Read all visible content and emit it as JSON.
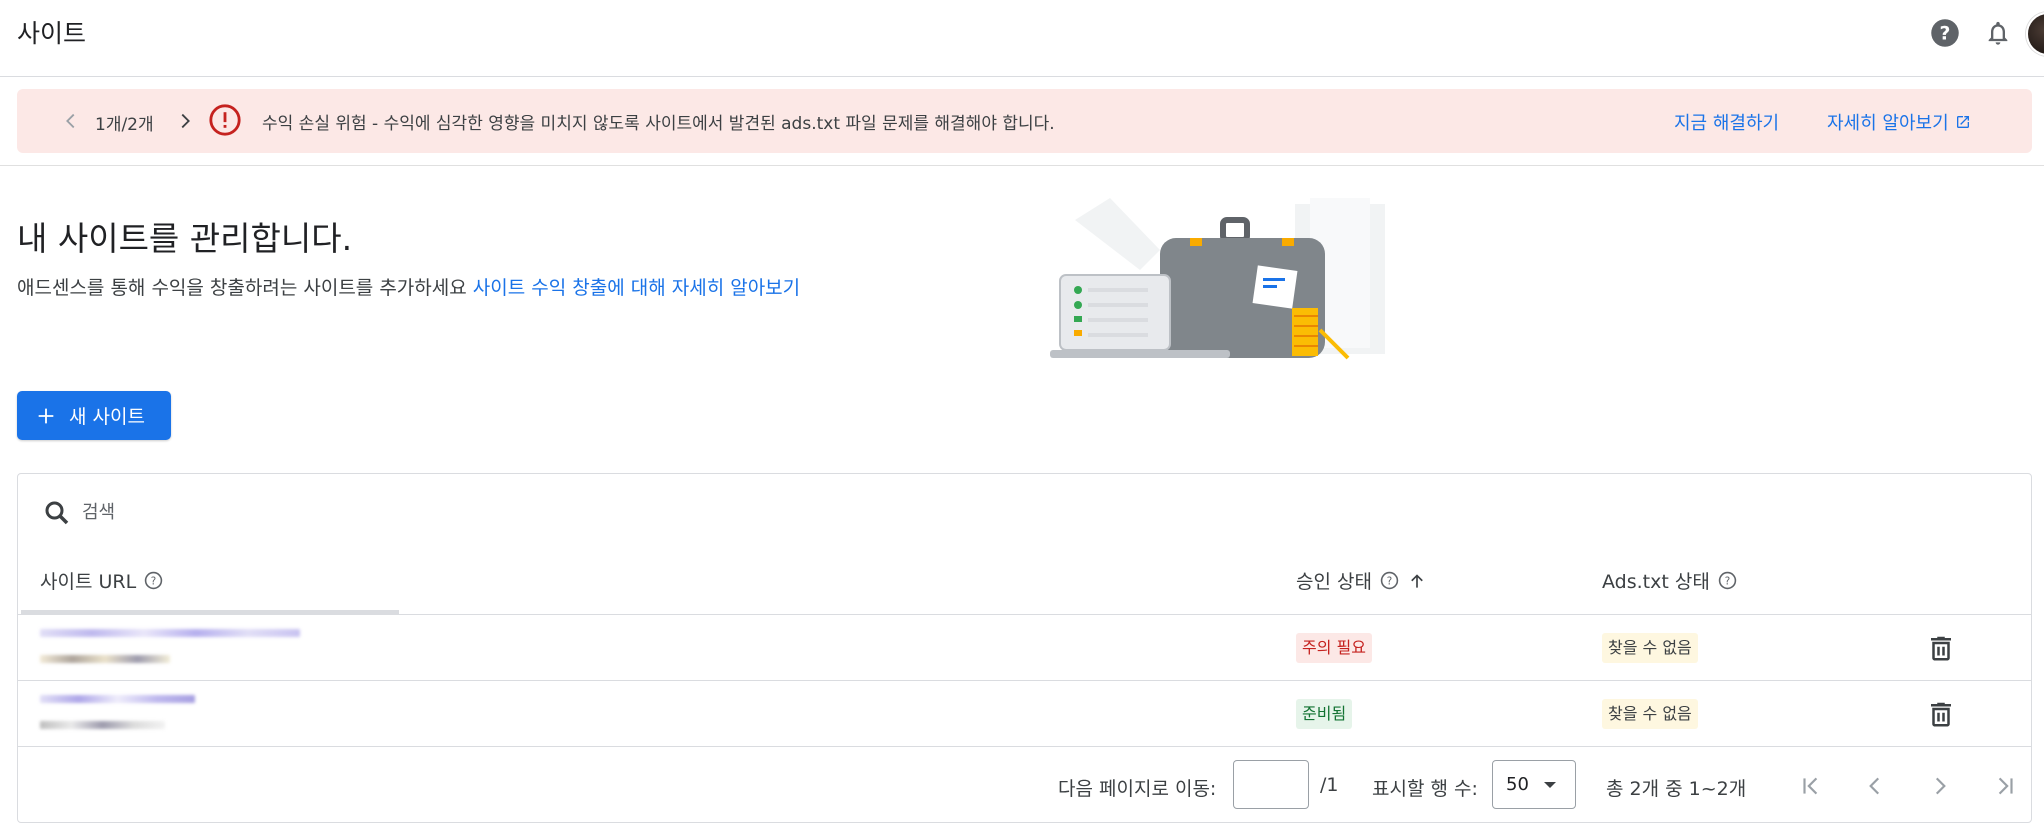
{
  "header": {
    "title": "사이트"
  },
  "banner": {
    "counter": "1개/2개",
    "message": "수익 손실 위험 - 수익에 심각한 영향을 미치지 않도록 사이트에서 발견된 ads.txt 파일 문제를 해결해야 합니다.",
    "fix_link": "지금 해결하기",
    "learn_link": "자세히 알아보기"
  },
  "hero": {
    "title": "내 사이트를 관리합니다.",
    "description": "애드센스를 통해 수익을 창출하려는 사이트를 추가하세요",
    "link": "사이트 수익 창출에 대해 자세히 알아보기"
  },
  "new_site_button": "새 사이트",
  "search": {
    "placeholder": "검색"
  },
  "table": {
    "columns": {
      "url": "사이트 URL",
      "approval": "승인 상태",
      "ads": "Ads.txt 상태"
    },
    "rows": [
      {
        "approval": "주의 필요",
        "ads": "찾을 수 없음"
      },
      {
        "approval": "준비됨",
        "ads": "찾을 수 없음"
      }
    ]
  },
  "pager": {
    "goto_label": "다음 페이지로 이동:",
    "goto_value": "",
    "page_total": "/1",
    "rows_label": "표시할 행 수:",
    "rows_value": "50",
    "range": "총 2개 중 1~2개"
  },
  "icons": {
    "help": "help-icon",
    "notifications": "bell-icon",
    "alert": "error-circle-icon",
    "search": "search-icon",
    "delete": "trash-icon"
  },
  "colors": {
    "accent": "#1a73e8",
    "banner_bg": "#fce8e6",
    "error": "#c5221f",
    "success": "#137333"
  }
}
